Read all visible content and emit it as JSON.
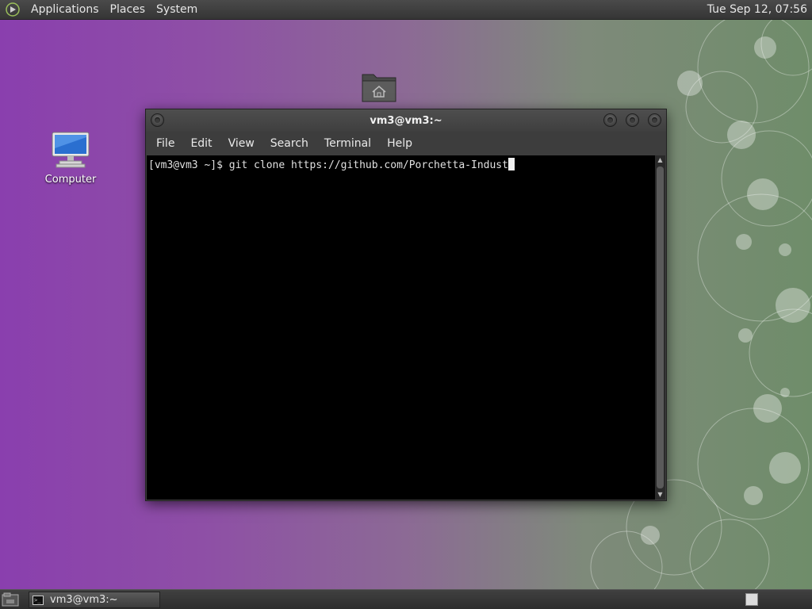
{
  "top_panel": {
    "menus": [
      "Applications",
      "Places",
      "System"
    ],
    "clock": "Tue Sep 12, 07:56"
  },
  "desktop": {
    "icons": [
      {
        "label": "Computer",
        "icon": "computer-icon"
      },
      {
        "label": "",
        "icon": "home-folder-icon"
      }
    ]
  },
  "terminal": {
    "title": "vm3@vm3:~",
    "menu": [
      "File",
      "Edit",
      "View",
      "Search",
      "Terminal",
      "Help"
    ],
    "lines": [
      "[vm3@vm3 ~]$ git clone https://github.com/Porchetta-Indust"
    ]
  },
  "taskbar": {
    "tasks": [
      {
        "label": "vm3@vm3:~",
        "icon": "terminal-icon"
      }
    ]
  },
  "colors": {
    "panel": "#3a3a3a",
    "terminal_bg": "#000000",
    "wallpaper_left": "#8a3fae",
    "wallpaper_right": "#6f8d6a"
  }
}
